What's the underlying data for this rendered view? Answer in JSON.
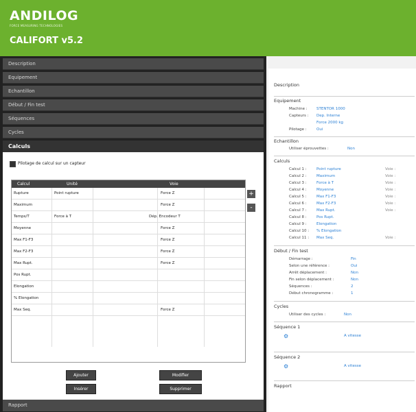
{
  "header": {
    "logo": "ANDILOG",
    "logo_sub": "FORCE MEASURING TECHNOLOGIES",
    "title": "CALIFORT v5.2"
  },
  "accordion": [
    "Description",
    "Equipement",
    "Echantillon",
    "Début / Fin test",
    "Séquences",
    "Cycles",
    "Calculs"
  ],
  "panel": {
    "checkbox_label": "Pilotage de calcul sur un capteur",
    "columns": [
      "Calcul",
      "Unité",
      "Voie"
    ],
    "rows": [
      [
        "Rupture",
        "Point rupture",
        "Force Z"
      ],
      [
        "Maximum",
        "",
        "Force Z"
      ],
      [
        "Temps/T",
        "Force à T",
        "Dép. Encodeur T"
      ],
      [
        "Moyenne",
        "",
        "Force Z"
      ],
      [
        "Max F1-F3",
        "",
        "Force Z"
      ],
      [
        "Max F2-F3",
        "",
        "Force Z"
      ],
      [
        "Max Rupt.",
        "",
        "Force Z"
      ],
      [
        "Pos Rupt.",
        "",
        ""
      ],
      [
        "Elongation",
        "",
        ""
      ],
      [
        "% Elongation",
        "",
        ""
      ],
      [
        "Max Seq.",
        "",
        "Force Z"
      ]
    ],
    "side_buttons": [
      "+",
      "-"
    ],
    "buttons": [
      "Ajouter",
      "Modifier",
      "Insérer",
      "Supprimer"
    ]
  },
  "bottom_item": "Rapport",
  "right": {
    "header": "Description",
    "equipement": {
      "title": "Equipement",
      "items": [
        {
          "label": "Machine :",
          "value": "STENTOR 1000"
        },
        {
          "label": "Capteurs :",
          "value": "Dep. Interne"
        },
        {
          "label": "",
          "value": "Force 2000 kg"
        },
        {
          "label": "Pilotage :",
          "value": "Oui"
        }
      ]
    },
    "echantillon": {
      "title": "Echantillon",
      "items": [
        {
          "label": "Utiliser éprouvettes :",
          "value": "Non"
        }
      ]
    },
    "calculs": {
      "title": "Calculs",
      "items": [
        {
          "label": "Calcul 1 :",
          "value": "Point rupture",
          "extra": "Voie :"
        },
        {
          "label": "Calcul 2 :",
          "value": "Maximum",
          "extra": "Voie :"
        },
        {
          "label": "Calcul 3 :",
          "value": "Force à T",
          "extra": "Voie :"
        },
        {
          "label": "Calcul 4 :",
          "value": "Moyenne",
          "extra": "Voie :"
        },
        {
          "label": "Calcul 5 :",
          "value": "Max F1-F3",
          "extra": "Voie :"
        },
        {
          "label": "Calcul 6 :",
          "value": "Max F2-F3",
          "extra": "Voie :"
        },
        {
          "label": "Calcul 7 :",
          "value": "Max Rupt.",
          "extra": "Voie :"
        },
        {
          "label": "Calcul 8 :",
          "value": "Pos Rupt.",
          "extra": ""
        },
        {
          "label": "Calcul 9 :",
          "value": "Elongation",
          "extra": ""
        },
        {
          "label": "Calcul 10 :",
          "value": "% Elongation",
          "extra": ""
        },
        {
          "label": "Calcul 11 :",
          "value": "Max Seq.",
          "extra": "Voie :"
        }
      ]
    },
    "debut_fin": {
      "title": "Début / Fin test",
      "items": [
        {
          "label": "Démarrage :",
          "value": "Fin"
        },
        {
          "label": "Selon une référence :",
          "value": "Oui"
        },
        {
          "label": "Arrêt déplacement :",
          "value": "Non"
        },
        {
          "label": "Fin selon déplacement :",
          "value": "Non"
        },
        {
          "label": "Séquences :",
          "value": "2"
        },
        {
          "label": "Début chronogramme :",
          "value": "1"
        }
      ]
    },
    "cycles": {
      "title": "Cycles",
      "items": [
        {
          "label": "Utiliser des cycles :",
          "value": "Non"
        }
      ]
    },
    "seq1": {
      "title": "Séquence 1",
      "icon": "⚙",
      "value": "A vitesse"
    },
    "seq2": {
      "title": "Séquence 2",
      "icon": "⚙",
      "value": "A vitesse"
    },
    "rapport": {
      "title": "Rapport"
    }
  }
}
